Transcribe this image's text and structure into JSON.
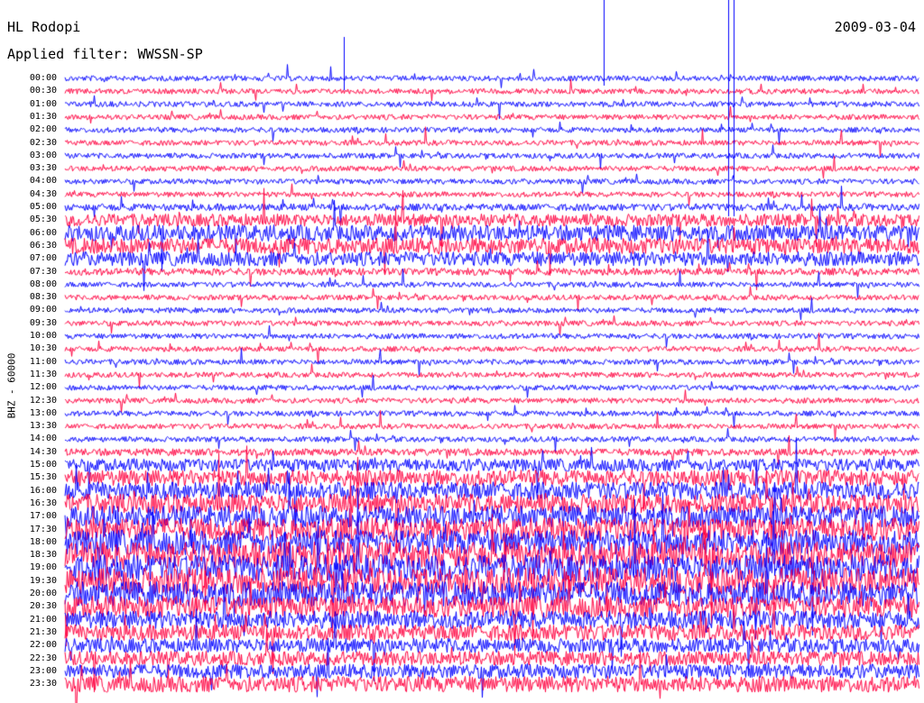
{
  "header": {
    "station": "HL Rodopi",
    "filter": "Applied filter: WWSSN-SP",
    "date": "2009-03-04"
  },
  "chart_data": {
    "type": "line",
    "title": "HL Rodopi",
    "subtitle": "Applied filter: WWSSN-SP",
    "date": "2009-03-04",
    "ylabel": "BHZ - 60000",
    "xlabel": "",
    "row_labels": [
      "00:00",
      "00:30",
      "01:00",
      "01:30",
      "02:00",
      "02:30",
      "03:00",
      "03:30",
      "04:00",
      "04:30",
      "05:00",
      "05:30",
      "06:00",
      "06:30",
      "07:00",
      "07:30",
      "08:00",
      "08:30",
      "09:00",
      "09:30",
      "10:00",
      "10:30",
      "11:00",
      "11:30",
      "12:00",
      "12:30",
      "13:00",
      "13:30",
      "14:00",
      "14:30",
      "15:00",
      "15:30",
      "16:00",
      "16:30",
      "17:00",
      "17:30",
      "18:00",
      "18:30",
      "19:00",
      "19:30",
      "20:00",
      "20:30",
      "21:00",
      "21:30",
      "22:00",
      "22:30",
      "23:00",
      "23:30"
    ],
    "row_interval_minutes": 30,
    "series_colors": [
      "#0000ff",
      "#ff0040"
    ],
    "noise_amplitude": [
      3,
      3,
      3,
      3,
      3,
      3,
      3,
      3,
      3,
      3,
      4,
      7,
      9,
      9,
      8,
      4,
      3,
      3,
      3,
      3,
      3,
      3,
      3,
      3,
      3,
      3,
      3,
      3,
      3,
      4,
      7,
      9,
      10,
      11,
      12,
      13,
      14,
      15,
      15,
      15,
      14,
      12,
      10,
      9,
      8,
      8,
      8,
      9
    ]
  }
}
